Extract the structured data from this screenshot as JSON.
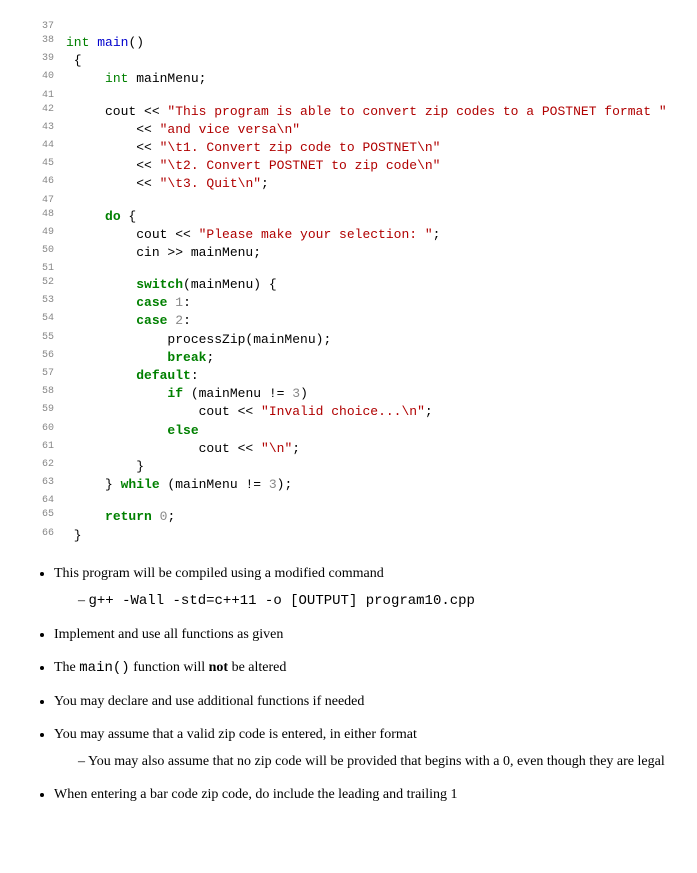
{
  "code": {
    "lines": [
      {
        "n": "37",
        "html": ""
      },
      {
        "n": "38",
        "html": "<span class='k-type'>int</span> <span class='k-func'>main</span>()"
      },
      {
        "n": "39",
        "html": " {"
      },
      {
        "n": "40",
        "html": "     <span class='k-type'>int</span> mainMenu;"
      },
      {
        "n": "41",
        "html": ""
      },
      {
        "n": "42",
        "html": "     cout &lt;&lt; <span class='k-str'>\"This program is able to convert zip codes to a POSTNET format \"</span>"
      },
      {
        "n": "43",
        "html": "         &lt;&lt; <span class='k-str'>\"and vice versa\\n\"</span>"
      },
      {
        "n": "44",
        "html": "         &lt;&lt; <span class='k-str'>\"\\t1. Convert zip code to POSTNET\\n\"</span>"
      },
      {
        "n": "45",
        "html": "         &lt;&lt; <span class='k-str'>\"\\t2. Convert POSTNET to zip code\\n\"</span>"
      },
      {
        "n": "46",
        "html": "         &lt;&lt; <span class='k-str'>\"\\t3. Quit\\n\"</span>;"
      },
      {
        "n": "47",
        "html": ""
      },
      {
        "n": "48",
        "html": "     <span class='k-key'>do</span> {"
      },
      {
        "n": "49",
        "html": "         cout &lt;&lt; <span class='k-str'>\"Please make your selection: \"</span>;"
      },
      {
        "n": "50",
        "html": "         cin &gt;&gt; mainMenu;"
      },
      {
        "n": "51",
        "html": ""
      },
      {
        "n": "52",
        "html": "         <span class='k-key'>switch</span>(mainMenu) {"
      },
      {
        "n": "53",
        "html": "         <span class='k-key'>case</span> <span class='k-num'>1</span>:"
      },
      {
        "n": "54",
        "html": "         <span class='k-key'>case</span> <span class='k-num'>2</span>:"
      },
      {
        "n": "55",
        "html": "             processZip(mainMenu);"
      },
      {
        "n": "56",
        "html": "             <span class='k-key'>break</span>;"
      },
      {
        "n": "57",
        "html": "         <span class='k-key'>default</span>:"
      },
      {
        "n": "58",
        "html": "             <span class='k-key'>if</span> (mainMenu != <span class='k-num'>3</span>)"
      },
      {
        "n": "59",
        "html": "                 cout &lt;&lt; <span class='k-str'>\"Invalid choice...\\n\"</span>;"
      },
      {
        "n": "60",
        "html": "             <span class='k-key'>else</span>"
      },
      {
        "n": "61",
        "html": "                 cout &lt;&lt; <span class='k-str'>\"\\n\"</span>;"
      },
      {
        "n": "62",
        "html": "         }"
      },
      {
        "n": "63",
        "html": "     } <span class='k-key'>while</span> (mainMenu != <span class='k-num'>3</span>);"
      },
      {
        "n": "64",
        "html": ""
      },
      {
        "n": "65",
        "html": "     <span class='k-key'>return</span> <span class='k-num'>0</span>;"
      },
      {
        "n": "66",
        "html": " }"
      }
    ]
  },
  "notes": {
    "b1": "This program will be compiled using a modified command",
    "b1_sub": "g++ -Wall -std=c++11 -o [OUTPUT] program10.cpp",
    "b2": "Implement and use all functions as given",
    "b3_pre": "The ",
    "b3_code": "main()",
    "b3_mid": " function will ",
    "b3_bold": "not",
    "b3_post": " be altered",
    "b4": "You may declare and use additional functions if needed",
    "b5": "You may assume that a valid zip code is entered, in either format",
    "b5_sub": "You may also assume that no zip code will be provided that begins with a 0, even though they are legal",
    "b6": "When entering a bar code zip code, do include the leading and trailing 1"
  }
}
